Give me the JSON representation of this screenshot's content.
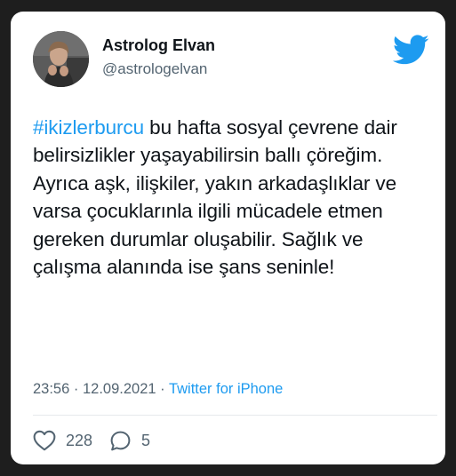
{
  "tweet": {
    "author": {
      "display_name": "Astrolog Elvan",
      "handle": "@astrologelvan"
    },
    "text": {
      "hashtag": "#ikizlerburcu",
      "body": " bu hafta sosyal çevrene dair belirsizlikler yaşayabilirsin ballı çöreğim. Ayrıca aşk, ilişkiler, yakın arkadaşlıklar ve varsa çocuklarınla ilgili mücadele etmen gereken durumlar oluşabilir. Sağlık ve çalışma alanında ise şans seninle!"
    },
    "meta": {
      "time": "23:56",
      "separator": " · ",
      "date": "12.09.2021",
      "source": "Twitter for iPhone"
    },
    "stats": {
      "likes": "228",
      "replies": "5"
    }
  },
  "icons": {
    "brand": "twitter-bird-icon",
    "like": "heart-icon",
    "reply": "reply-bubble-icon"
  },
  "colors": {
    "brand": "#1d9bf0",
    "text": "#0f1419",
    "secondary": "#536471",
    "background": "#1e1e1e"
  }
}
